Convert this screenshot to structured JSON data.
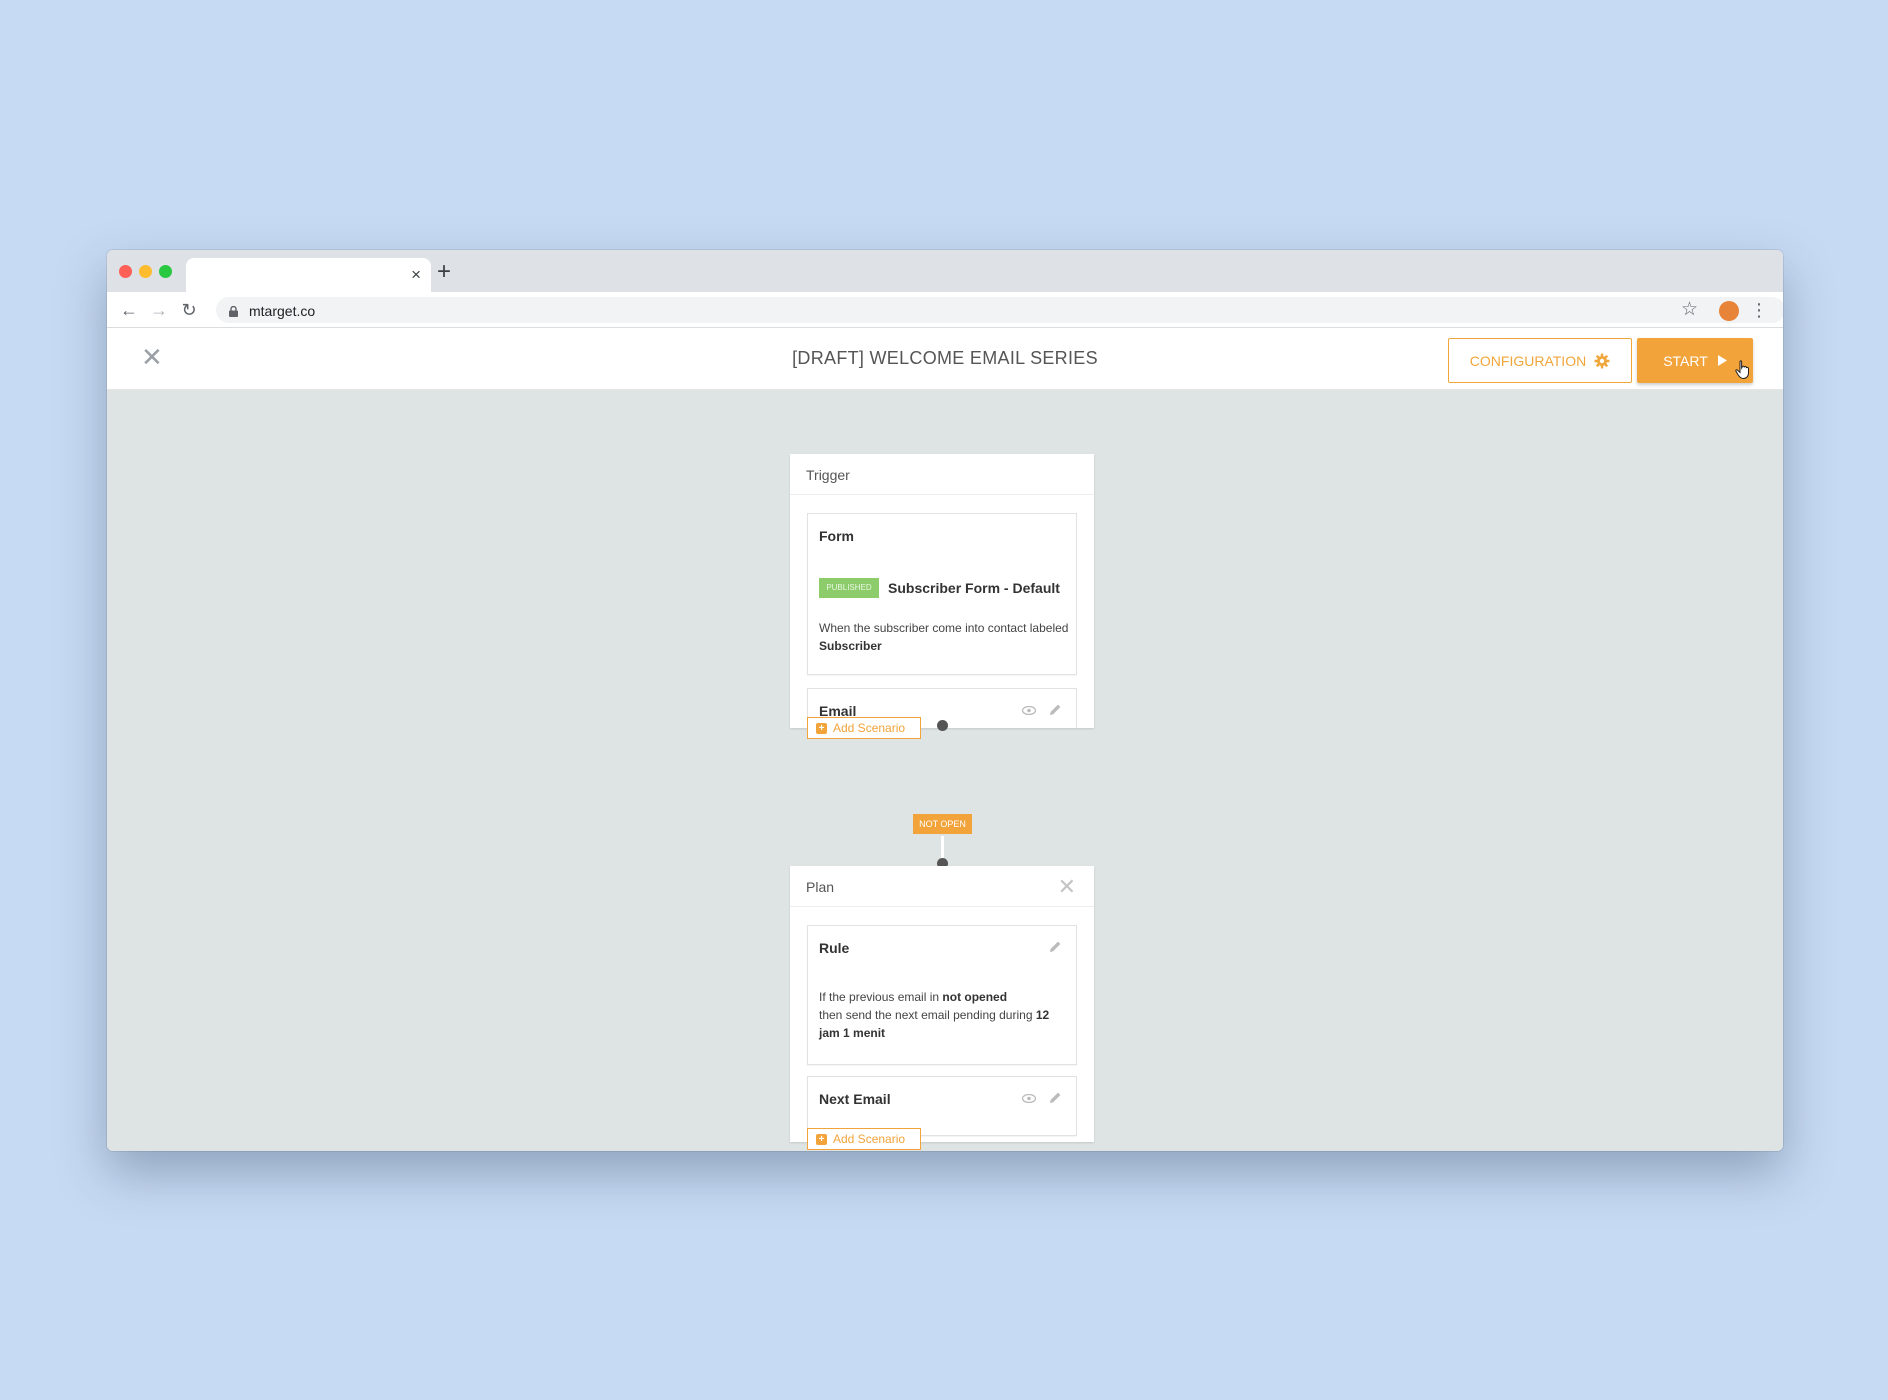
{
  "browser": {
    "url": "mtarget.co",
    "new_tab": "+",
    "tab_close": "×"
  },
  "header": {
    "title": "[DRAFT] WELCOME EMAIL SERIES",
    "config_label": "CONFIGURATION",
    "start_label": "START"
  },
  "trigger": {
    "heading": "Trigger",
    "form_card": {
      "title": "Form",
      "badge": "PUBLISHED",
      "form_name": "Subscriber Form - Default",
      "desc_prefix": "When the subscriber come into contact labeled ",
      "desc_bold": "Subscriber"
    },
    "email_card": {
      "title": "Email"
    },
    "add_scenario": "Add Scenario"
  },
  "connector": {
    "label": "NOT OPEN"
  },
  "plan": {
    "heading": "Plan",
    "rule_card": {
      "title": "Rule",
      "line1_prefix": "If the previous email in ",
      "line1_bold": "not opened",
      "line2_prefix": "then send the next email pending during ",
      "line2_bold": "12 jam 1 menit"
    },
    "next_card": {
      "title": "Next Email"
    },
    "add_scenario": "Add Scenario"
  },
  "colors": {
    "accent": "#f2a33a",
    "canvas": "#dde4e3",
    "published": "#8dcc6b",
    "backdrop": "#c7daf3"
  }
}
